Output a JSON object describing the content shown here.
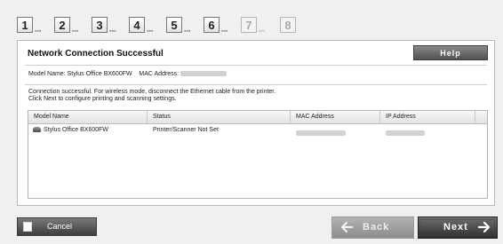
{
  "steps": [
    {
      "number": "1",
      "active": true
    },
    {
      "number": "2",
      "active": true
    },
    {
      "number": "3",
      "active": true
    },
    {
      "number": "4",
      "active": true
    },
    {
      "number": "5",
      "active": true
    },
    {
      "number": "6",
      "active": true
    },
    {
      "number": "7",
      "active": false
    },
    {
      "number": "8",
      "active": false
    }
  ],
  "panel": {
    "title": "Network Connection Successful",
    "help_label": "Help",
    "model_label": "Model Name:",
    "model_value": "Stylus Office BX600FW",
    "mac_label": "MAC Address:",
    "message_line1": "Connection successful. For wireless mode,  disconnect the Ethernet cable from the printer.",
    "message_line2": "Click Next to configure printing and scanning settings."
  },
  "table": {
    "headers": [
      "Model Name",
      "Status",
      "MAC Address",
      "IP Address"
    ],
    "rows": [
      {
        "model": "Stylus Office BX600FW",
        "status": "Printer/Scanner Not Set"
      }
    ]
  },
  "buttons": {
    "cancel": "Cancel",
    "back": "Back",
    "next": "Next"
  },
  "icons": {
    "printer": "printer-icon",
    "back_arrow": "arrow-left-icon",
    "next_arrow": "arrow-right-icon"
  }
}
